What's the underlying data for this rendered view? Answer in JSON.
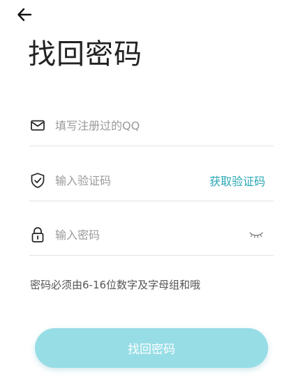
{
  "header": {
    "back_icon": "arrow-left-icon",
    "title": "找回密码"
  },
  "form": {
    "qq": {
      "icon": "mail-icon",
      "placeholder": "填写注册过的QQ",
      "value": ""
    },
    "code": {
      "icon": "shield-check-icon",
      "placeholder": "输入验证码",
      "value": "",
      "get_code_label": "获取验证码"
    },
    "password": {
      "icon": "lock-icon",
      "placeholder": "输入密码",
      "value": "",
      "toggle_icon": "eye-closed-icon"
    },
    "hint": "密码必须由6-16位数字及字母组和哦"
  },
  "submit": {
    "label": "找回密码"
  },
  "colors": {
    "accent": "#2aa7b5",
    "button_bg": "#97dde6",
    "divider": "#e4e4e4"
  }
}
